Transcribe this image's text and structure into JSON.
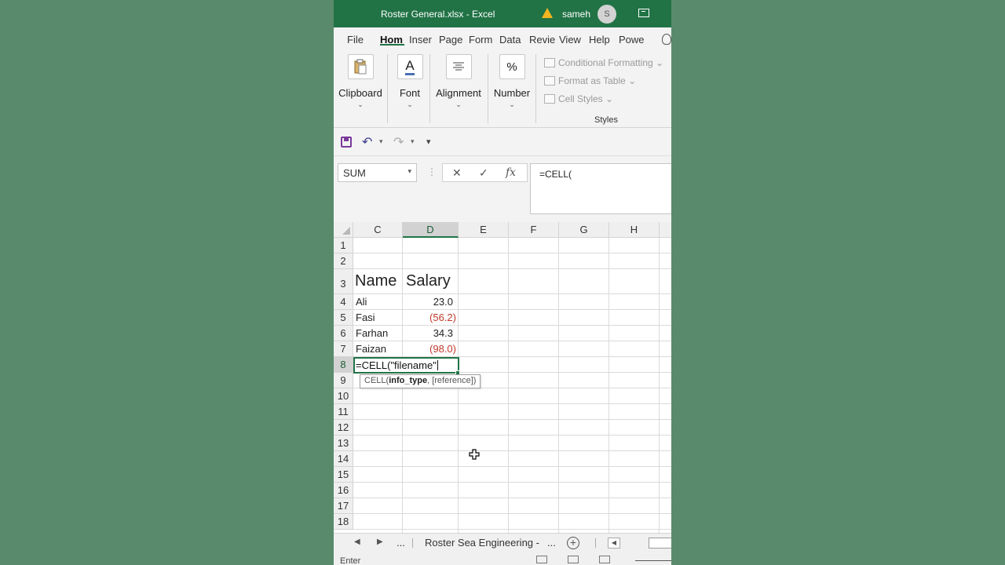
{
  "window": {
    "title": "Roster General.xlsx  -  Excel",
    "user": "sameh",
    "avatar_initial": "S"
  },
  "tabs": [
    "File",
    "Hom",
    "Inser",
    "Page",
    "Form",
    "Data",
    "Revie",
    "View",
    "Help",
    "Powe"
  ],
  "ribbon": {
    "clipboard": "Clipboard",
    "font": "Font",
    "font_icon": "A",
    "alignment": "Alignment",
    "number": "Number",
    "number_icon": "%",
    "conditional_formatting": "Conditional Formatting",
    "format_as_table": "Format as Table",
    "cell_styles": "Cell Styles",
    "styles_group": "Styles"
  },
  "formula_bar": {
    "name_box": "SUM",
    "formula": "=CELL("
  },
  "columns": [
    "C",
    "D",
    "E",
    "F",
    "G",
    "H"
  ],
  "rows": [
    "1",
    "2",
    "3",
    "4",
    "5",
    "6",
    "7",
    "8",
    "9",
    "10",
    "11",
    "12",
    "13",
    "14",
    "15",
    "16",
    "17",
    "18"
  ],
  "sheet": {
    "headers": {
      "name": "Name",
      "salary": "Salary"
    },
    "data": [
      {
        "name": "Ali",
        "salary": "23.0"
      },
      {
        "name": "Fasi",
        "salary": "(56.2)"
      },
      {
        "name": "Farhan",
        "salary": "34.3"
      },
      {
        "name": "Faizan",
        "salary": "(98.0)"
      }
    ],
    "editing_cell": "=CELL(\"filename\"",
    "tooltip": {
      "fn": "CELL(",
      "arg1": "info_type",
      "rest": ", [reference])"
    }
  },
  "sheet_tabs": {
    "more_left": "...",
    "active": "Roster Sea Engineering",
    "more_right": "..."
  },
  "status": {
    "mode": "Enter"
  },
  "colors": {
    "accent": "#217346",
    "negative": "#c0392b",
    "background": "#5a8a6c"
  }
}
